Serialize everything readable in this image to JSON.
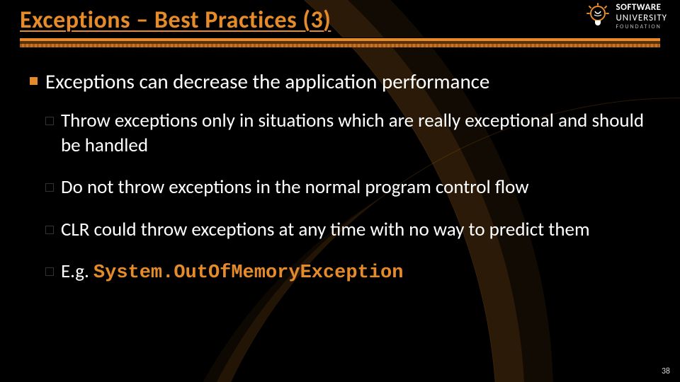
{
  "logo": {
    "line1": "SOFTWARE",
    "line2": "UNIVERSITY",
    "line3": "FOUNDATION"
  },
  "title": "Exceptions – Best Practices (3)",
  "bullets": {
    "main": "Exceptions can decrease the application performance",
    "sub": [
      "Throw exceptions only in situations which are really exceptional and should be handled",
      "Do not throw exceptions in the normal program control flow",
      "CLR could throw exceptions at any time with no way to predict them"
    ],
    "example_prefix": "E.g. ",
    "example_code": "System.OutOfMemoryException"
  },
  "page_number": "38",
  "colors": {
    "accent": "#e58b2a"
  }
}
